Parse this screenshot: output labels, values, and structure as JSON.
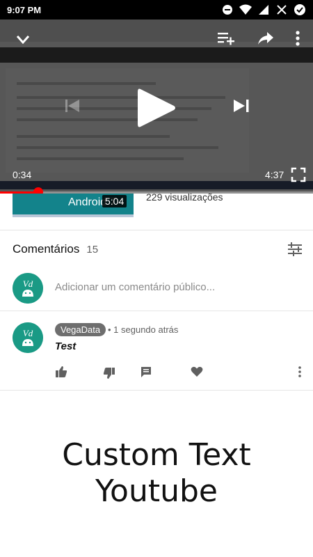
{
  "status_bar": {
    "time": "9:07 PM"
  },
  "player": {
    "current_time": "0:34",
    "duration": "4:37",
    "progress": 0.123
  },
  "related_video": {
    "title": "Android 7",
    "duration_badge": "5:04",
    "views": "229 visualizações"
  },
  "comments": {
    "title": "Comentários",
    "count": "15",
    "add_placeholder": "Adicionar um comentário público...",
    "items": [
      {
        "author": "VegaData",
        "time": "• 1 segundo atrás",
        "text": "Test"
      }
    ]
  },
  "custom_text": {
    "line1": "Custom Text",
    "line2": "Youtube"
  },
  "colors": {
    "accent": "#ff0000",
    "avatar_bg": "#1a9a85",
    "thumb_bg": "#13838b"
  }
}
